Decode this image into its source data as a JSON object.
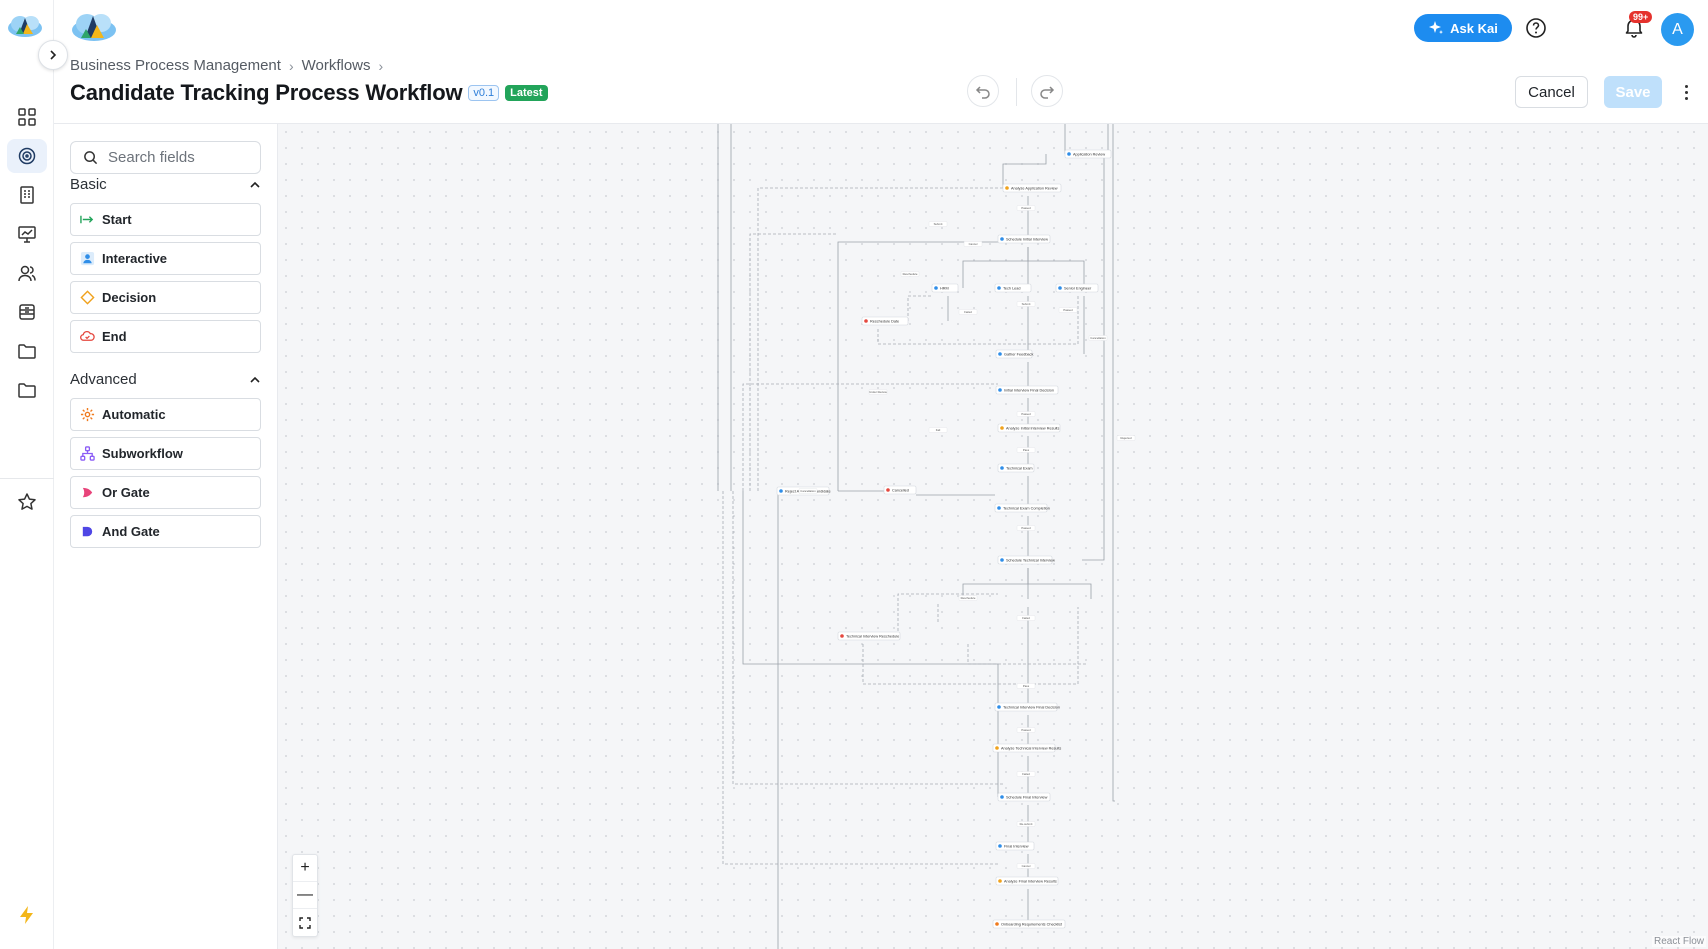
{
  "breadcrumb": [
    "Business Process Management",
    "Workflows"
  ],
  "title": "Candidate Tracking Process Workflow",
  "version": "v0.1",
  "version_tag": "Latest",
  "header": {
    "ask_label": "Ask Kai",
    "notifications": "99+",
    "avatar_initial": "A",
    "cancel_label": "Cancel",
    "save_label": "Save"
  },
  "palette": {
    "search_placeholder": "Search fields",
    "basic_title": "Basic",
    "basic": [
      {
        "label": "Start",
        "icon": "arrow-right-icon",
        "color": "#22a45a"
      },
      {
        "label": "Interactive",
        "icon": "person-icon",
        "color": "#2f8ee8"
      },
      {
        "label": "Decision",
        "icon": "diamond-icon",
        "color": "#f0a21d"
      },
      {
        "label": "End",
        "icon": "cloud-check-icon",
        "color": "#e5483f"
      }
    ],
    "advanced_title": "Advanced",
    "advanced": [
      {
        "label": "Automatic",
        "icon": "gear-icon",
        "color": "#f07a1d"
      },
      {
        "label": "Subworkflow",
        "icon": "hierarchy-icon",
        "color": "#8b5cf6"
      },
      {
        "label": "Or Gate",
        "icon": "or-gate-icon",
        "color": "#e8447a"
      },
      {
        "label": "And Gate",
        "icon": "and-gate-icon",
        "color": "#4f46e5"
      }
    ]
  },
  "canvas": {
    "attribution": "React Flow",
    "zoom_in": "+",
    "zoom_out": "—"
  },
  "flow": {
    "nodes": [
      "Application Review",
      "Analyze Application Review",
      "Schedule Initial Interview",
      "HRM",
      "Tech Lead",
      "Senior Engineer",
      "Reschedule Date",
      "Gather Feedback",
      "Initial Interview Final Decision",
      "Analyze Initial Interview Results",
      "Technical Exam",
      "Cancelled",
      "Technical Exam Completion",
      "Reject Applicant Candidate",
      "Schedule Technical Interview",
      "Technical Interview Reschedule",
      "Technical Interview Final Decision",
      "Analyze Technical Interview Results",
      "Schedule Final Interview",
      "Final Interview",
      "Analyze Final Interview Results",
      "Onboarding Requirements Checklist"
    ],
    "edge_labels": [
      "Submit",
      "Passed",
      "Failed",
      "Reschedule",
      "Cancel",
      "Rejected",
      "Under Review",
      "Re-submit",
      "Pass",
      "Fail",
      "Cancellation"
    ]
  }
}
